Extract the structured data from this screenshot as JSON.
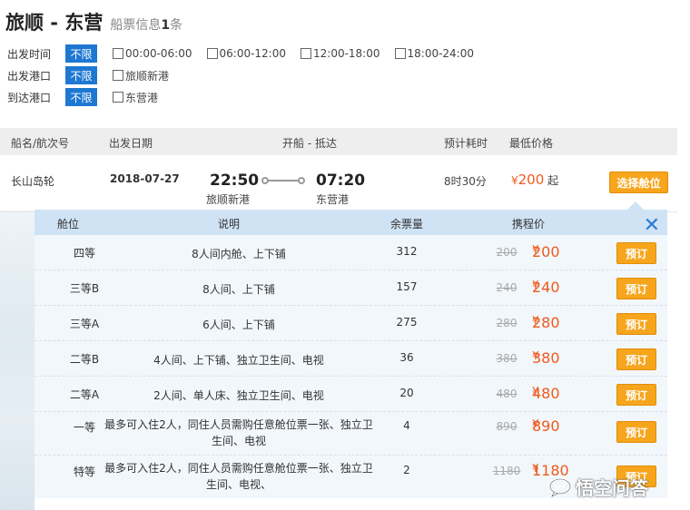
{
  "header": {
    "route": "旅顺 - 东营",
    "info_prefix": "船票信息",
    "info_count": "1",
    "info_suffix": "条"
  },
  "filters": [
    {
      "label": "出发时间",
      "tag": "不限",
      "options": [
        "00:00-06:00",
        "06:00-12:00",
        "12:00-18:00",
        "18:00-24:00"
      ]
    },
    {
      "label": "出发港口",
      "tag": "不限",
      "options": [
        "旅顺新港"
      ]
    },
    {
      "label": "到达港口",
      "tag": "不限",
      "options": [
        "东营港"
      ]
    }
  ],
  "list_header": {
    "ship": "船名/航次号",
    "date": "出发日期",
    "times": "开船 - 抵达",
    "duration": "预计耗时",
    "min_price": "最低价格"
  },
  "route": {
    "ship_name": "长山岛轮",
    "date": "2018-07-27",
    "depart_time": "22:50",
    "depart_port": "旅顺新港",
    "arrive_time": "07:20",
    "arrive_port": "东营港",
    "duration": "8时30分",
    "currency": "¥",
    "price": "200",
    "price_suffix": "起",
    "select_label": "选择舱位"
  },
  "seat_panel": {
    "headers": {
      "class": "舱位",
      "desc": "说明",
      "tickets": "余票量",
      "price": "携程价"
    },
    "close_icon": "close-icon",
    "book_label": "预订",
    "currency": "¥",
    "rows": [
      {
        "class": "四等",
        "desc": "8人间内舱、上下铺",
        "tickets": "312",
        "old_price": "200",
        "price": "200"
      },
      {
        "class": "三等B",
        "desc": "8人间、上下铺",
        "tickets": "157",
        "old_price": "240",
        "price": "240"
      },
      {
        "class": "三等A",
        "desc": "6人间、上下铺",
        "tickets": "275",
        "old_price": "280",
        "price": "280"
      },
      {
        "class": "二等B",
        "desc": "4人间、上下铺、独立卫生间、电视",
        "tickets": "36",
        "old_price": "380",
        "price": "380"
      },
      {
        "class": "二等A",
        "desc": "2人间、单人床、独立卫生间、电视",
        "tickets": "20",
        "old_price": "480",
        "price": "480"
      },
      {
        "class": "一等",
        "desc": "最多可入住2人，同住人员需购任意舱位票一张、独立卫生间、电视",
        "tickets": "4",
        "old_price": "890",
        "price": "890"
      },
      {
        "class": "特等",
        "desc": "最多可入住2人，同住人员需购任意舱位票一张、独立卫生间、电视、",
        "tickets": "2",
        "old_price": "1180",
        "price": "1180"
      }
    ]
  },
  "watermark": {
    "text": "悟空问答"
  },
  "colors": {
    "accent_blue": "#1e78d2",
    "orange_button": "#f7a51c",
    "price_orange": "#f05a1a",
    "panel_bg": "#f2f7fc",
    "panel_header": "#cfe3f5"
  }
}
